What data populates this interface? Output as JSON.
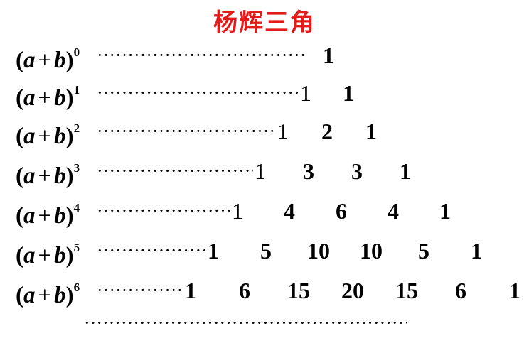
{
  "title": "杨辉三角",
  "expression": {
    "open": "(",
    "a": "a",
    "plus": "+",
    "b": "b",
    "close": ")"
  },
  "rows": [
    {
      "power": "0",
      "coefficients": [
        "1"
      ]
    },
    {
      "power": "1",
      "coefficients": [
        "1",
        "1"
      ]
    },
    {
      "power": "2",
      "coefficients": [
        "1",
        "2",
        "1"
      ]
    },
    {
      "power": "3",
      "coefficients": [
        "1",
        "3",
        "3",
        "1"
      ]
    },
    {
      "power": "4",
      "coefficients": [
        "1",
        "4",
        "6",
        "4",
        "1"
      ]
    },
    {
      "power": "5",
      "coefficients": [
        "1",
        "5",
        "10",
        "10",
        "5",
        "1"
      ]
    },
    {
      "power": "6",
      "coefficients": [
        "1",
        "6",
        "15",
        "20",
        "15",
        "6",
        "1"
      ]
    }
  ],
  "title_color": "#e31b1b"
}
